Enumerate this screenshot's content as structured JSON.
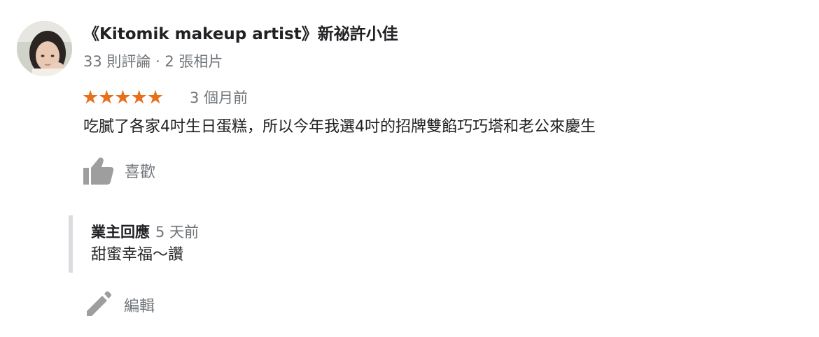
{
  "review": {
    "reviewer_name": "《Kitomik makeup artist》新祕許小佳",
    "reviewer_meta": "33 則評論 · 2 張相片",
    "rating": 5,
    "stars": "★★★★★",
    "date": "3 個月前",
    "text": "吃膩了各家4吋生日蛋糕，所以今年我選4吋的招牌雙餡巧巧塔和老公來慶生"
  },
  "actions": {
    "like_label": "喜歡",
    "edit_label": "編輯"
  },
  "owner_reply": {
    "title": "業主回應",
    "date": "5 天前",
    "text": "甜蜜幸福～讚"
  },
  "colors": {
    "star": "#e7711b",
    "secondary_text": "#70757a",
    "icon": "#9e9e9e",
    "reply_border": "#dadce0"
  }
}
